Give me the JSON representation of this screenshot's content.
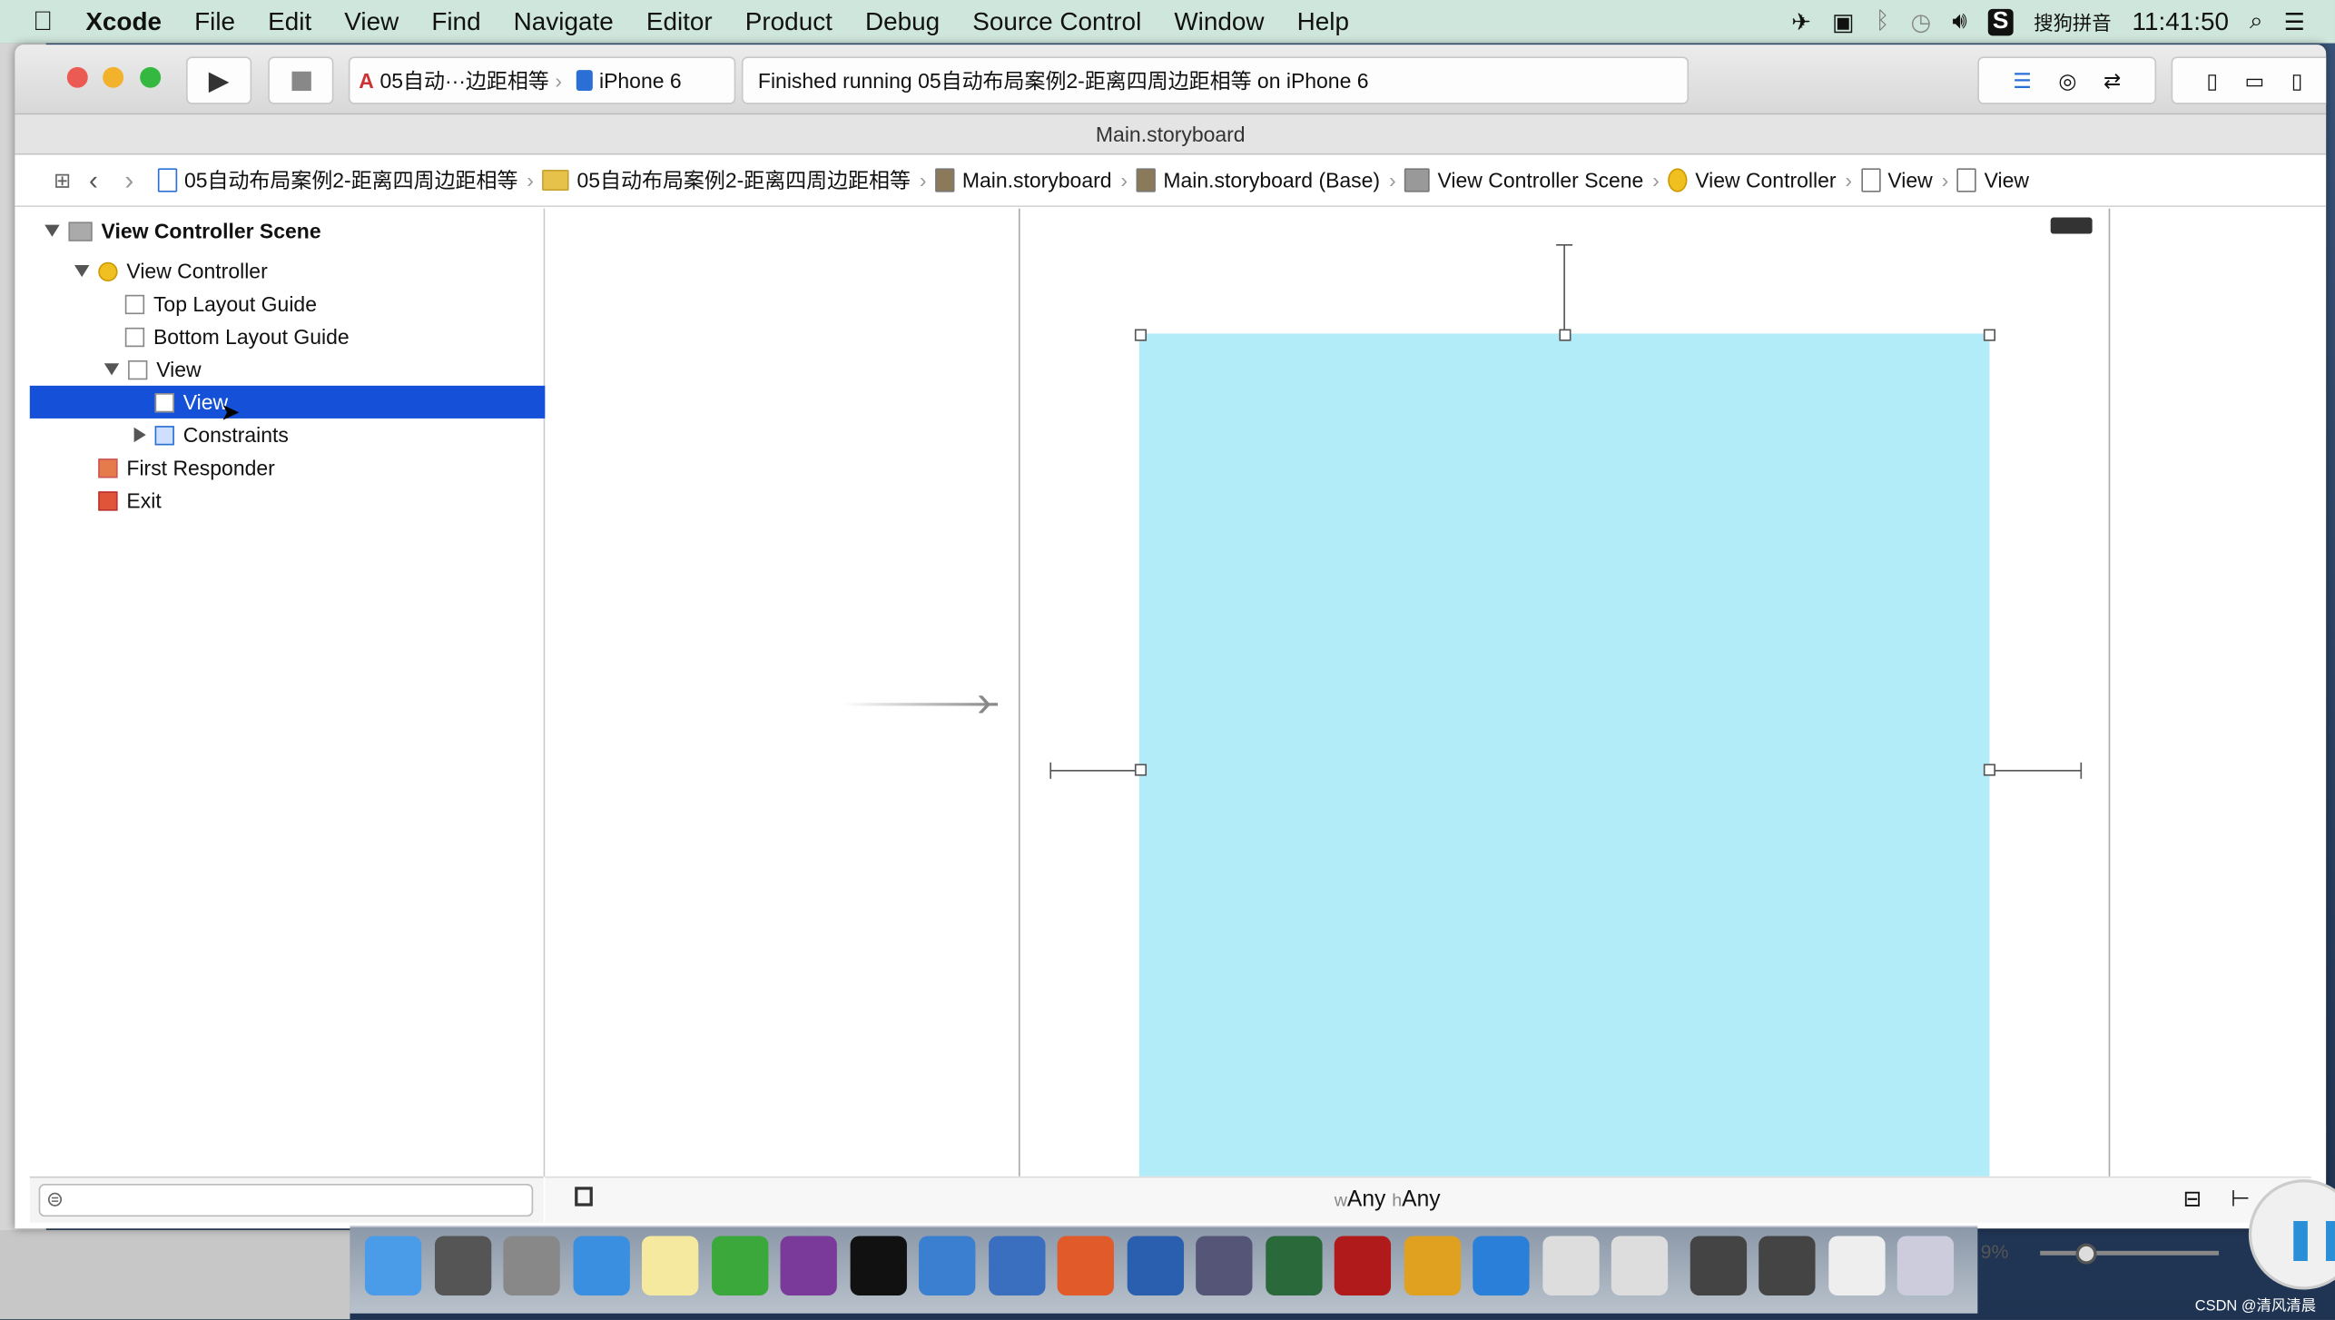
{
  "menubar": {
    "app": "Xcode",
    "items": [
      "File",
      "Edit",
      "View",
      "Find",
      "Navigate",
      "Editor",
      "Product",
      "Debug",
      "Source Control",
      "Window",
      "Help"
    ],
    "input_method": "搜狗拼音",
    "clock": "11:41:50",
    "icons": [
      "apple-icon",
      "airplane-icon",
      "screen-record-icon",
      "bluetooth-icon",
      "time-machine-icon",
      "volume-icon",
      "sogou-icon",
      "spotlight-icon",
      "notification-list-icon"
    ]
  },
  "toolbar": {
    "scheme": "05自动···边距相等",
    "device": "iPhone 6",
    "status": "Finished running 05自动布局案例2-距离四周边距相等 on iPhone 6"
  },
  "title": "Main.storyboard",
  "jumpbar": [
    "05自动布局案例2-距离四周边距相等",
    "05自动布局案例2-距离四周边距相等",
    "Main.storyboard",
    "Main.storyboard (Base)",
    "View Controller Scene",
    "View Controller",
    "View",
    "View"
  ],
  "outline": {
    "scene": "View Controller Scene",
    "vc": "View Controller",
    "top": "Top Layout Guide",
    "bottom": "Bottom Layout Guide",
    "view": "View",
    "subview": "View",
    "constraints": "Constraints",
    "responder": "First Responder",
    "exit": "Exit"
  },
  "canvas": {
    "size_w": "w",
    "size_w_val": "Any",
    "size_h": "h",
    "size_h_val": "Any",
    "view_color": "#b3ecf9"
  },
  "dock": [
    "finder",
    "system-preferences",
    "launchpad",
    "safari",
    "notes",
    "excel",
    "onenote",
    "terminal",
    "xcode",
    "xcode-alt",
    "powerpoint",
    "scissors-app",
    "imovie",
    "ftp-app",
    "filezilla",
    "pages",
    "word",
    "instruments",
    "instruments-alt",
    "screen-share",
    "screen-share-alt",
    "preview",
    "trash"
  ],
  "zoom_text": "9%",
  "watermark": "CSDN @清风清晨"
}
